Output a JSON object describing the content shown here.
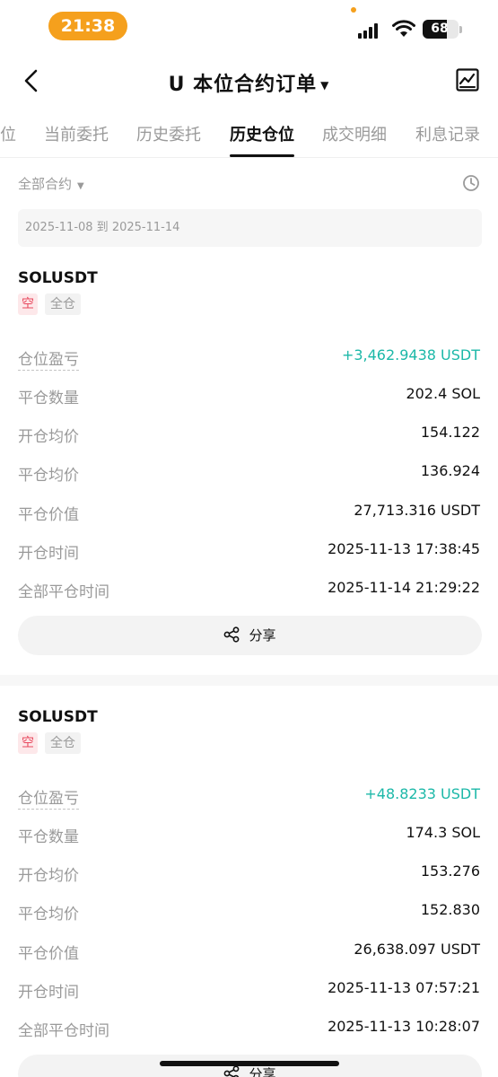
{
  "status_bar": {
    "time": "21:38",
    "battery": "68"
  },
  "nav": {
    "title": "U 本位合约订单"
  },
  "tabs": [
    {
      "label": "位"
    },
    {
      "label": "当前委托"
    },
    {
      "label": "历史委托"
    },
    {
      "label": "历史仓位",
      "active": true
    },
    {
      "label": "成交明细"
    },
    {
      "label": "利息记录"
    }
  ],
  "filter": {
    "contract_label": "全部合约",
    "date_range": "2025-11-08 到 2025-11-14"
  },
  "positions": [
    {
      "symbol": "SOLUSDT",
      "side_badge": "空",
      "margin_badge": "全仓",
      "rows": [
        {
          "label": "仓位盈亏",
          "value": "+3,462.9438 USDT"
        },
        {
          "label": "平仓数量",
          "value": "202.4 SOL"
        },
        {
          "label": "开仓均价",
          "value": "154.122"
        },
        {
          "label": "平仓均价",
          "value": "136.924"
        },
        {
          "label": "平仓价值",
          "value": "27,713.316 USDT"
        },
        {
          "label": "开仓时间",
          "value": "2025-11-13 17:38:45"
        },
        {
          "label": "全部平仓时间",
          "value": "2025-11-14 21:29:22"
        }
      ],
      "share_label": "分享"
    },
    {
      "symbol": "SOLUSDT",
      "side_badge": "空",
      "margin_badge": "全仓",
      "rows": [
        {
          "label": "仓位盈亏",
          "value": "+48.8233 USDT"
        },
        {
          "label": "平仓数量",
          "value": "174.3 SOL"
        },
        {
          "label": "开仓均价",
          "value": "153.276"
        },
        {
          "label": "平仓均价",
          "value": "152.830"
        },
        {
          "label": "平仓价值",
          "value": "26,638.097 USDT"
        },
        {
          "label": "开仓时间",
          "value": "2025-11-13 07:57:21"
        },
        {
          "label": "全部平仓时间",
          "value": "2025-11-13 10:28:07"
        }
      ],
      "share_label": "分享"
    }
  ],
  "colors": {
    "positive": "#1cb8a8",
    "short_badge": "#e84a5f",
    "time_pill": "#f5a01d"
  }
}
